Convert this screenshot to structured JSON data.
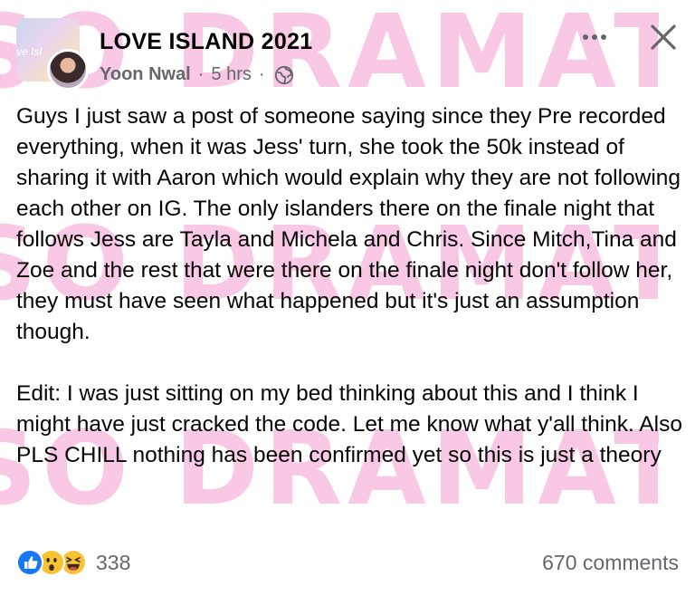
{
  "watermark": "SO DRAMATIC",
  "post": {
    "group_name": "LOVE ISLAND 2021",
    "group_avatar_text": "ve Isl",
    "author": "Yoon Nwal",
    "separator": "·",
    "time": "5 hrs",
    "audience_icon": "globe-icon",
    "body": "Guys I just saw a post of someone saying since they Pre recorded everything, when it was Jess' turn, she took the 50k instead of sharing it with Aaron which would explain why they are not following each other on IG. The only islanders there on the finale night that follows Jess are Tayla and Michela and Chris. Since Mitch,Tina and Zoe and the rest that were there on the finale night don't follow her, they must have seen what happened but it's just an assumption though.\n\nEdit: I was just sitting on my bed thinking about this and I think I might have just cracked the code. Let me know what y'all think. Also PLS CHILL nothing has been confirmed yet so this is just a theory"
  },
  "reactions": {
    "icons": [
      "like-icon",
      "wow-icon",
      "haha-icon"
    ],
    "count": "338"
  },
  "comments_label": "670 comments",
  "colors": {
    "watermark": "#f9c8e4",
    "secondary_text": "#65676b",
    "like_blue": "#1877f2",
    "emoji_yellow": "#f7c335"
  }
}
